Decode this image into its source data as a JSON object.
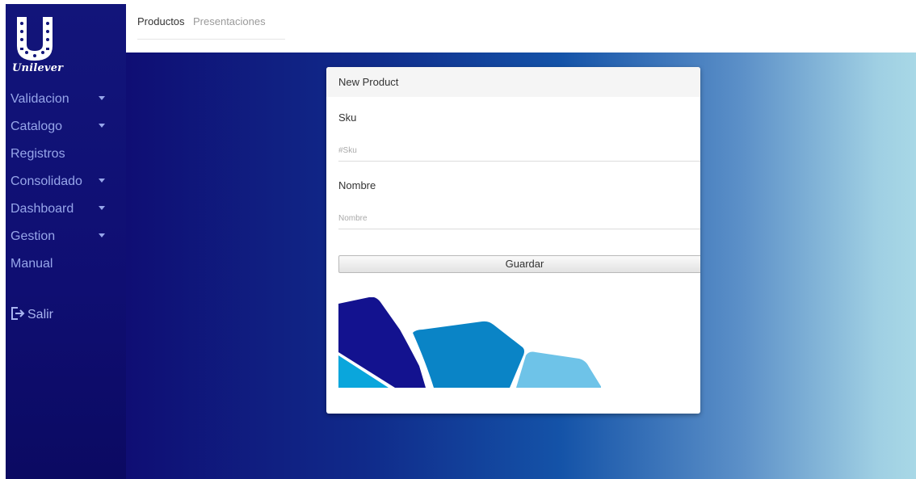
{
  "brand": {
    "name": "Unilever"
  },
  "sidebar": {
    "items": [
      {
        "label": "Validacion",
        "has_caret": true
      },
      {
        "label": "Catalogo",
        "has_caret": true
      },
      {
        "label": "Registros",
        "has_caret": false
      },
      {
        "label": "Consolidado",
        "has_caret": true
      },
      {
        "label": "Dashboard",
        "has_caret": true
      },
      {
        "label": "Gestion",
        "has_caret": true
      },
      {
        "label": "Manual",
        "has_caret": false
      }
    ],
    "logout": {
      "label": "Salir",
      "icon": "logout-icon"
    }
  },
  "header": {
    "tabs": [
      {
        "label": "Productos",
        "active": true
      },
      {
        "label": "Presentaciones",
        "active": false
      }
    ]
  },
  "form": {
    "title": "New Product",
    "fields": [
      {
        "label": "Sku",
        "placeholder": "#Sku",
        "value": ""
      },
      {
        "label": "Nombre",
        "placeholder": "Nombre",
        "value": ""
      }
    ],
    "submit_label": "Guardar"
  },
  "colors": {
    "sidebar_bg": "#12157a",
    "sidebar_text": "#97a6ea",
    "shape_dark": "#13128f",
    "shape_mid": "#0a84c6",
    "shape_light": "#6ec3e8",
    "shape_cyan": "#0aa6dc"
  }
}
